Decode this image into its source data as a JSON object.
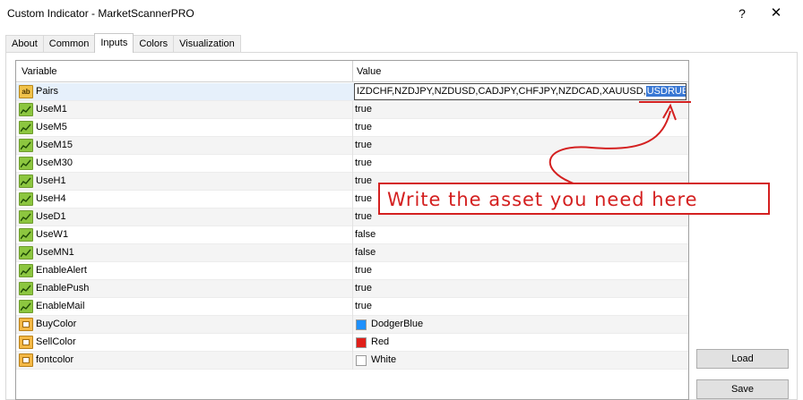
{
  "window": {
    "title": "Custom Indicator - MarketScannerPRO",
    "help_label": "?",
    "close_label": "✕"
  },
  "tabs": [
    {
      "label": "About"
    },
    {
      "label": "Common"
    },
    {
      "label": "Inputs",
      "active": true
    },
    {
      "label": "Colors"
    },
    {
      "label": "Visualization"
    }
  ],
  "grid": {
    "header_variable": "Variable",
    "header_value": "Value",
    "pairs_row": {
      "icon": "ab-string-icon",
      "name": "Pairs",
      "value_prefix": "IZDCHF,NZDJPY,NZDUSD,CADJPY,CHFJPY,NZDCAD,XAUUSD,",
      "value_selected": "USDRUB"
    },
    "bool_rows": [
      {
        "name": "UseM1",
        "value": "true"
      },
      {
        "name": "UseM5",
        "value": "true"
      },
      {
        "name": "UseM15",
        "value": "true"
      },
      {
        "name": "UseM30",
        "value": "true"
      },
      {
        "name": "UseH1",
        "value": "true"
      },
      {
        "name": "UseH4",
        "value": "true"
      },
      {
        "name": "UseD1",
        "value": "true"
      },
      {
        "name": "UseW1",
        "value": "false"
      },
      {
        "name": "UseMN1",
        "value": "false"
      },
      {
        "name": "EnableAlert",
        "value": "true"
      },
      {
        "name": "EnablePush",
        "value": "true"
      },
      {
        "name": "EnableMail",
        "value": "true"
      }
    ],
    "color_rows": [
      {
        "name": "BuyColor",
        "value": "DodgerBlue",
        "swatch": "#1e90ff"
      },
      {
        "name": "SellColor",
        "value": "Red",
        "swatch": "#e0201a"
      },
      {
        "name": "fontcolor",
        "value": "White",
        "swatch": "#ffffff"
      }
    ]
  },
  "annotation": {
    "text": "Write the asset you need here",
    "color": "#d42020"
  },
  "buttons": {
    "load_label": "Load",
    "save_label": "Save"
  }
}
